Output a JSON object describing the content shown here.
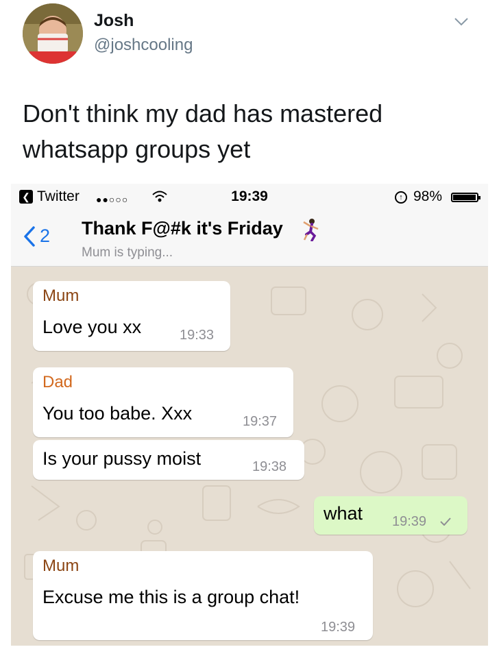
{
  "tweet": {
    "author_name": "Josh",
    "author_handle": "@joshcooling",
    "text": "Don't think my dad has mastered whatsapp groups yet"
  },
  "statusbar": {
    "back_app": "Twitter",
    "signal": "●●○○○",
    "time": "19:39",
    "battery": "98%"
  },
  "chat": {
    "back_count": "2",
    "title": "Thank F@#k it's Friday",
    "subtitle": "Mum is typing..."
  },
  "messages": [
    {
      "sender": "Mum",
      "text": "Love you xx",
      "time": "19:33"
    },
    {
      "sender": "Dad",
      "text": "You too babe. Xxx",
      "time": "19:37"
    },
    {
      "text": "Is your pussy moist",
      "time": "19:38"
    },
    {
      "text": "what",
      "time": "19:39",
      "outgoing": true
    },
    {
      "sender": "Mum",
      "text": "Excuse me this is a group chat!",
      "time": "19:39"
    }
  ],
  "colors": {
    "mum": "#8b4513",
    "dad": "#d2691e",
    "link": "#1a73e8",
    "outgoing_bubble": "#dcf8c6",
    "wallpaper": "#e6ded2"
  },
  "icons": [
    "chevron-down-icon",
    "back-chevron-icon",
    "dancer-emoji-icon",
    "wifi-icon",
    "lock-rotation-icon",
    "battery-icon",
    "read-check-icon"
  ]
}
